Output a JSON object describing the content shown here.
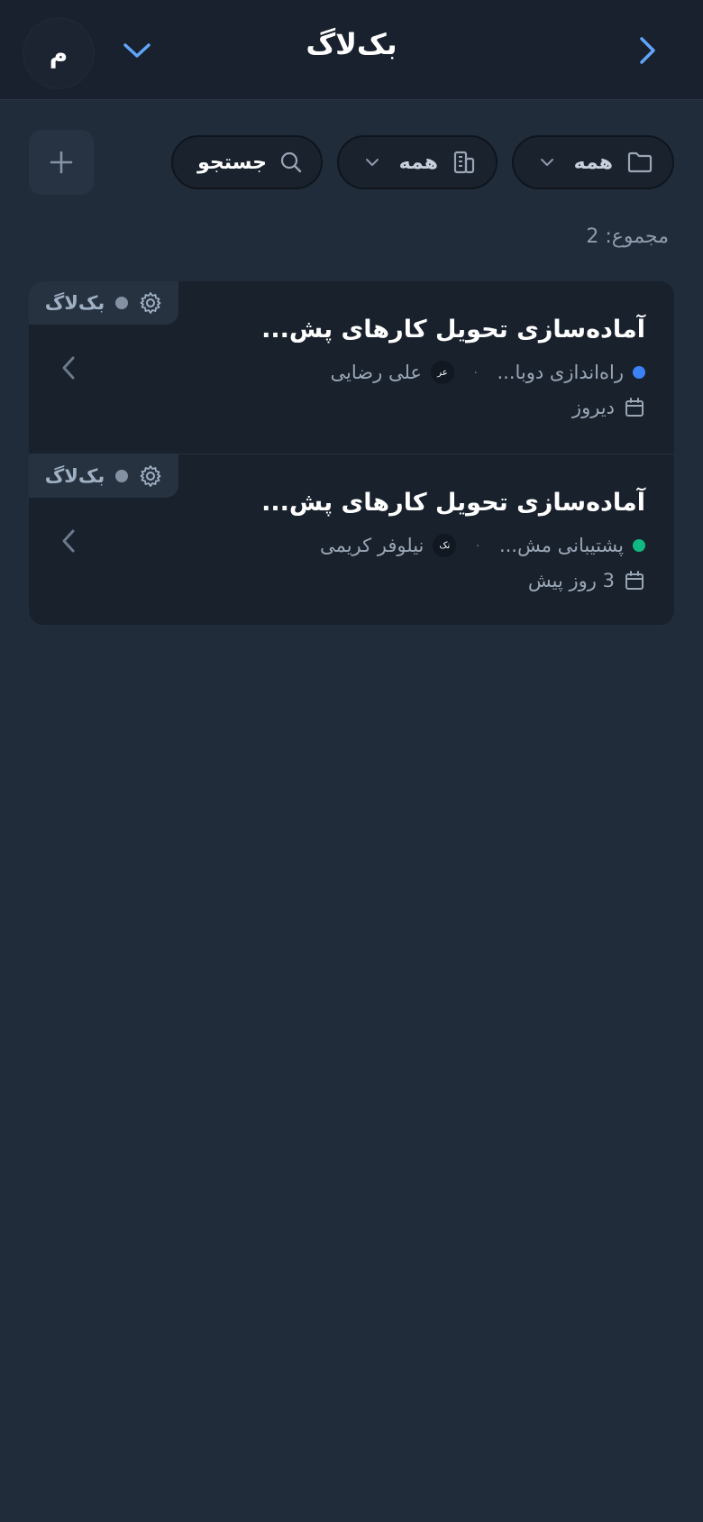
{
  "header": {
    "title": "بک‌لاگ",
    "avatar_letter": "م",
    "back_icon": "chevron-right-icon",
    "dropdown_icon": "chevron-down-icon"
  },
  "filters": {
    "folder": {
      "label": "همه",
      "icon": "folder-icon"
    },
    "building": {
      "label": "همه",
      "icon": "building-icon"
    },
    "search": {
      "label": "جستجو",
      "icon": "search-icon"
    },
    "add_icon": "plus-icon"
  },
  "total_label": "مجموع: 2",
  "items": [
    {
      "badge": "بک‌لاگ",
      "title": "آماده‌سازی تحویل کارهای پش...",
      "project": "راه‌اندازی دوبا...",
      "project_color": "#3b82f6",
      "separator": "۰",
      "assignee_initials": "عر",
      "assignee": "علی رضایی",
      "date": "دیروز"
    },
    {
      "badge": "بک‌لاگ",
      "title": "آماده‌سازی تحویل کارهای پش...",
      "project": "پشتیبانی مش...",
      "project_color": "#10b981",
      "separator": "۰",
      "assignee_initials": "نک",
      "assignee": "نیلوفر کریمی",
      "date": "3 روز پیش"
    }
  ],
  "colors": {
    "accent": "#60a5fa",
    "background": "#212c3b",
    "header": "#18212d",
    "card": "#18212c"
  }
}
